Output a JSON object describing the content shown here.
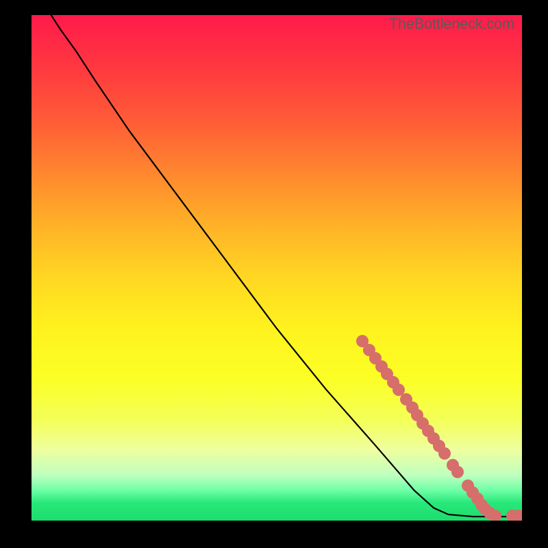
{
  "watermark": "TheBottleneck.com",
  "chart_data": {
    "type": "line",
    "title": "",
    "xlabel": "",
    "ylabel": "",
    "xlim": [
      0,
      100
    ],
    "ylim": [
      0,
      100
    ],
    "curve": [
      {
        "x": 4,
        "y": 100
      },
      {
        "x": 6,
        "y": 97
      },
      {
        "x": 9,
        "y": 93
      },
      {
        "x": 13,
        "y": 87
      },
      {
        "x": 20,
        "y": 77
      },
      {
        "x": 30,
        "y": 64
      },
      {
        "x": 40,
        "y": 51
      },
      {
        "x": 50,
        "y": 38
      },
      {
        "x": 60,
        "y": 26
      },
      {
        "x": 70,
        "y": 15
      },
      {
        "x": 78,
        "y": 6
      },
      {
        "x": 82,
        "y": 2.5
      },
      {
        "x": 85,
        "y": 1.2
      },
      {
        "x": 90,
        "y": 0.8
      },
      {
        "x": 100,
        "y": 0.8
      }
    ],
    "points": [
      {
        "x": 67.5,
        "y": 35.5
      },
      {
        "x": 68.8,
        "y": 33.8
      },
      {
        "x": 70.1,
        "y": 32.1
      },
      {
        "x": 71.3,
        "y": 30.5
      },
      {
        "x": 72.5,
        "y": 29.0
      },
      {
        "x": 73.7,
        "y": 27.4
      },
      {
        "x": 74.8,
        "y": 25.9
      },
      {
        "x": 76.4,
        "y": 24.0
      },
      {
        "x": 77.6,
        "y": 22.3
      },
      {
        "x": 78.7,
        "y": 20.8
      },
      {
        "x": 79.8,
        "y": 19.3
      },
      {
        "x": 80.9,
        "y": 17.8
      },
      {
        "x": 82.0,
        "y": 16.3
      },
      {
        "x": 83.1,
        "y": 14.8
      },
      {
        "x": 84.2,
        "y": 13.3
      },
      {
        "x": 85.9,
        "y": 11.0
      },
      {
        "x": 86.9,
        "y": 9.6
      },
      {
        "x": 89.0,
        "y": 6.9
      },
      {
        "x": 89.9,
        "y": 5.6
      },
      {
        "x": 90.9,
        "y": 4.3
      },
      {
        "x": 91.8,
        "y": 3.1
      },
      {
        "x": 92.5,
        "y": 2.3
      },
      {
        "x": 93.4,
        "y": 1.5
      },
      {
        "x": 94.5,
        "y": 1.0
      },
      {
        "x": 98.0,
        "y": 0.9
      },
      {
        "x": 99.3,
        "y": 0.9
      },
      {
        "x": 102.6,
        "y": 0.9
      },
      {
        "x": 103.8,
        "y": 0.9
      }
    ],
    "colors": {
      "curve": "#000000",
      "point": "#d66e6b",
      "gradient_top": "#ff1a4b",
      "gradient_bottom": "#1edc6e"
    }
  }
}
